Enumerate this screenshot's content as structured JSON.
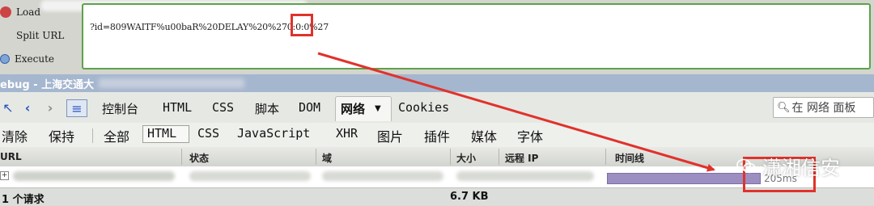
{
  "hackbar": {
    "buttons": [
      "Load",
      "Split URL",
      "Execute"
    ],
    "url_value": "?id=809WAITF%u00baR%20DELAY%20%270:0:0%27"
  },
  "firebug": {
    "title_prefix": "ebug - 上海交通大",
    "tabs": [
      "控制台",
      "HTML",
      "CSS",
      "脚本",
      "DOM",
      "网络",
      "Cookies"
    ],
    "active_tab": "网络",
    "search_placeholder": "在 网络 面板",
    "filters": [
      "清除",
      "保持",
      "全部",
      "HTML",
      "CSS",
      "JavaScript",
      "XHR",
      "图片",
      "插件",
      "媒体",
      "字体"
    ],
    "columns": [
      "URL",
      "状态",
      "域",
      "大小",
      "远程 IP",
      "时间线"
    ],
    "request": {
      "timing": "205ms"
    },
    "summary": {
      "count": "1 个请求",
      "size": "6.7 KB"
    }
  },
  "watermark": "潇湘信安",
  "colors": {
    "annotation_red": "#e0322c",
    "timeline_bar": "#9c8ec0"
  }
}
